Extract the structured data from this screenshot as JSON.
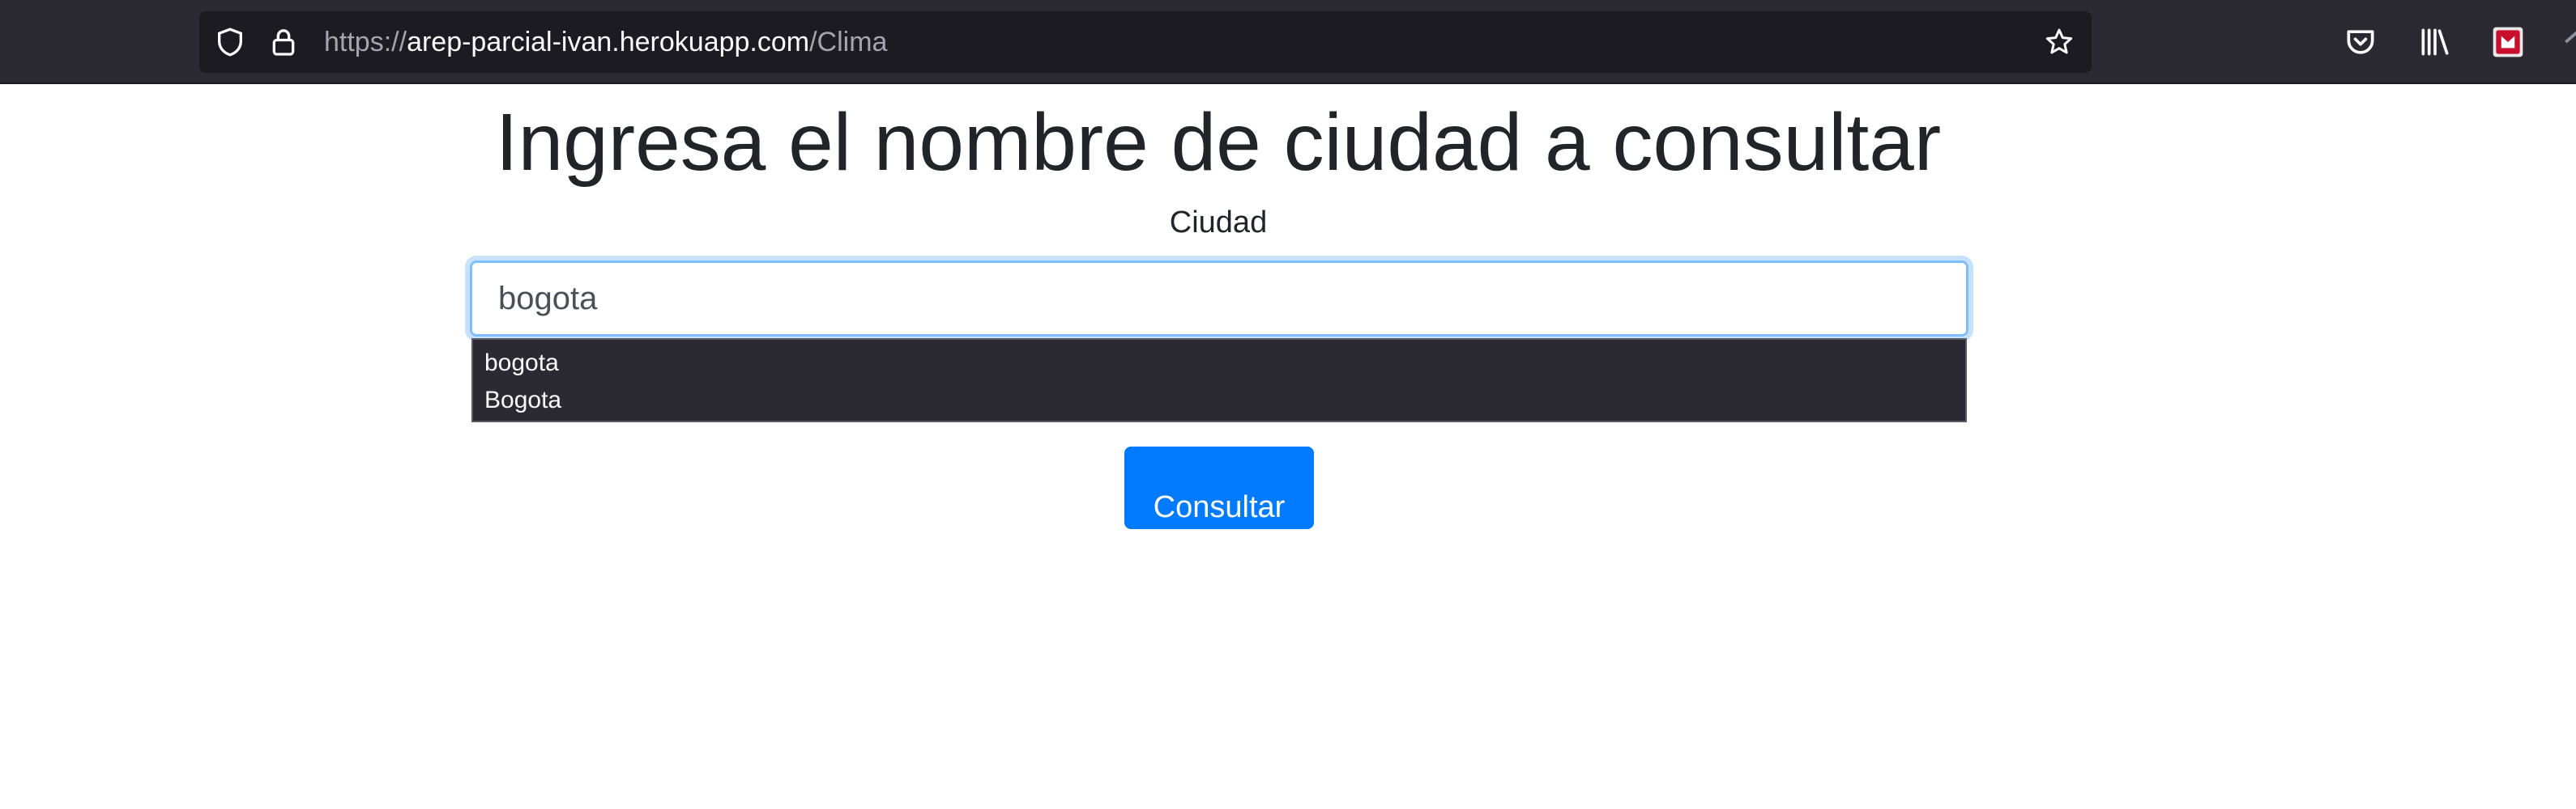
{
  "browser": {
    "url": {
      "scheme": "https://",
      "host": "arep-parcial-ivan.herokuapp.com",
      "path": "/Clima"
    },
    "icons": {
      "tracking": "shield-icon",
      "security": "lock-icon",
      "bookmark": "star-icon",
      "pocket": "pocket-icon",
      "library": "library-icon",
      "extension": "extension-icon"
    }
  },
  "page": {
    "heading": "Ingresa el nombre de ciudad a consultar",
    "input_label": "Ciudad",
    "input_value": "bogota",
    "submit_label": "Consultar",
    "autocomplete": [
      "bogota",
      "Bogota"
    ]
  },
  "colors": {
    "primary": "#007bff",
    "focus_border": "#80bdff",
    "toolbar": "#2b2a33",
    "urlbar": "#1c1b22"
  }
}
